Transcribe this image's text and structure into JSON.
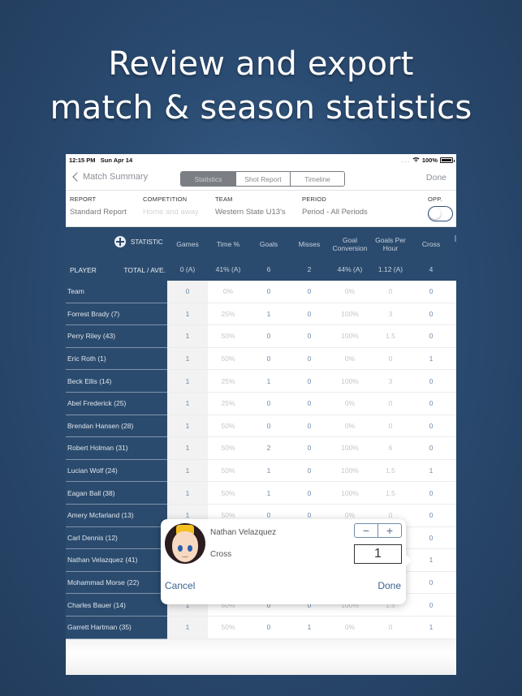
{
  "headline": {
    "line1": "Review and export",
    "line2": "match & season statistics"
  },
  "status_bar": {
    "time": "12:15 PM",
    "date": "Sun Apr 14",
    "signal": "....",
    "battery": "100%"
  },
  "navbar": {
    "back_label": "Match Summary",
    "tabs": [
      {
        "label": "Statistics",
        "selected": true
      },
      {
        "label": "Shot Report",
        "selected": false
      },
      {
        "label": "Timeline",
        "selected": false
      }
    ],
    "done_label": "Done"
  },
  "filters": {
    "report": {
      "label": "REPORT",
      "value": "Standard Report"
    },
    "competition": {
      "label": "COMPETITION",
      "value": "Home and away"
    },
    "team": {
      "label": "TEAM",
      "value": "Western State U13's"
    },
    "period": {
      "label": "PERIOD",
      "value": "Period - All Periods"
    },
    "opp": {
      "label": "OPP.",
      "on": false
    }
  },
  "table": {
    "statistic_label": "STATISTIC",
    "player_label": "PLAYER",
    "total_label": "TOTAL / AVE.",
    "columns": [
      {
        "name": "Games",
        "total": "0 (A)"
      },
      {
        "name": "Time %",
        "total": "41% (A)"
      },
      {
        "name": "Goals",
        "total": "6"
      },
      {
        "name": "Misses",
        "total": "2"
      },
      {
        "name": "Goal Conversion",
        "total": "44% (A)"
      },
      {
        "name": "Goals Per Hour",
        "total": "1.12 (A)"
      },
      {
        "name": "Cross",
        "total": "4"
      }
    ],
    "rows": [
      {
        "player": "Team",
        "values": [
          "0",
          "0%",
          "0",
          "0",
          "0%",
          "0",
          "0"
        ]
      },
      {
        "player": "Forrest Brady (7)",
        "values": [
          "1",
          "25%",
          "1",
          "0",
          "100%",
          "3",
          "0"
        ]
      },
      {
        "player": "Perry Riley (43)",
        "values": [
          "1",
          "50%",
          "0",
          "0",
          "100%",
          "1.5",
          "0"
        ]
      },
      {
        "player": "Eric Roth (1)",
        "values": [
          "1",
          "50%",
          "0",
          "0",
          "0%",
          "0",
          "1"
        ]
      },
      {
        "player": "Beck Ellis (14)",
        "values": [
          "1",
          "25%",
          "1",
          "0",
          "100%",
          "3",
          "0"
        ]
      },
      {
        "player": "Abel Frederick (25)",
        "values": [
          "1",
          "25%",
          "0",
          "0",
          "0%",
          "0",
          "0"
        ]
      },
      {
        "player": "Brendan Hansen (28)",
        "values": [
          "1",
          "50%",
          "0",
          "0",
          "0%",
          "0",
          "0"
        ]
      },
      {
        "player": "Robert Holman (31)",
        "values": [
          "1",
          "50%",
          "2",
          "0",
          "100%",
          "6",
          "0"
        ]
      },
      {
        "player": "Lucian Wolf (24)",
        "values": [
          "1",
          "50%",
          "1",
          "0",
          "100%",
          "1.5",
          "1"
        ]
      },
      {
        "player": "Eagan Ball (38)",
        "values": [
          "1",
          "50%",
          "1",
          "0",
          "100%",
          "1.5",
          "0"
        ]
      },
      {
        "player": "Amery Mcfarland (13)",
        "values": [
          "1",
          "50%",
          "0",
          "0",
          "0%",
          "0",
          "0"
        ]
      },
      {
        "player": "Carl Dennis (12)",
        "values": [
          "",
          "",
          "",
          "",
          "",
          "",
          "0"
        ]
      },
      {
        "player": "Nathan Velazquez (41)",
        "values": [
          "",
          "",
          "",
          "",
          "",
          "",
          "1"
        ]
      },
      {
        "player": "Mohammad Morse (22)",
        "values": [
          "",
          "",
          "",
          "",
          "",
          "",
          "0"
        ]
      },
      {
        "player": "Charles Bauer (14)",
        "values": [
          "1",
          "50%",
          "0",
          "0",
          "100%",
          "1.5",
          "0"
        ]
      },
      {
        "player": "Garrett Hartman (35)",
        "values": [
          "1",
          "50%",
          "0",
          "1",
          "0%",
          "0",
          "1"
        ]
      }
    ]
  },
  "popup": {
    "player_name": "Nathan Velazquez",
    "statistic": "Cross",
    "minus_label": "−",
    "plus_label": "+",
    "value": "1",
    "cancel_label": "Cancel",
    "done_label": "Done"
  }
}
